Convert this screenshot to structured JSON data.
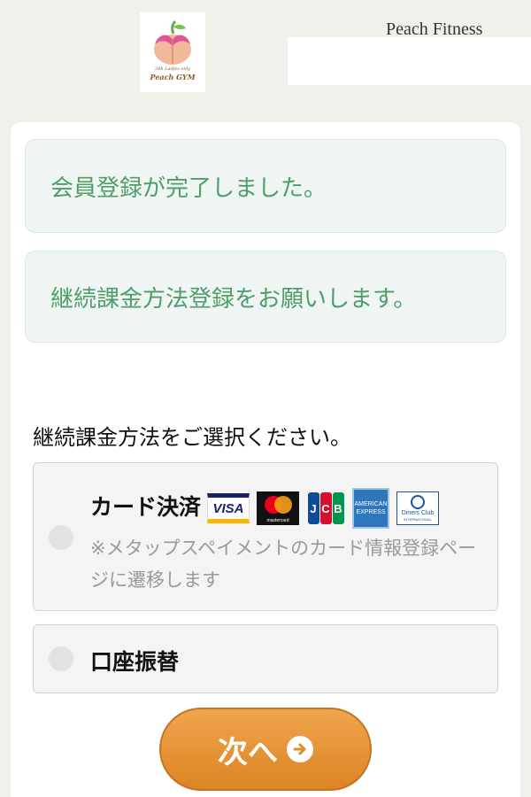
{
  "header": {
    "logo_small": "24h Ladies only",
    "logo_name": "Peach GYM",
    "brand": "Peach Fitness"
  },
  "messages": [
    "会員登録が完了しました。",
    "継続課金方法登録をお願いします。"
  ],
  "payment": {
    "label": "継続課金方法をご選択ください。",
    "options": [
      {
        "label": "カード決済",
        "note": "※メタップスペイメントのカード情報登録ページに遷移します",
        "card_brands": {
          "visa": "VISA",
          "mastercard": "mastercard",
          "jcb": [
            "J",
            "C",
            "B"
          ],
          "amex": [
            "AMERICAN",
            "EXPRESS"
          ],
          "diners": [
            "Diners Club",
            "INTERNATIONAL"
          ]
        }
      },
      {
        "label": "口座振替"
      }
    ]
  },
  "next_button": {
    "label": "次へ",
    "icon": "arrow-right-circle-icon"
  },
  "colors": {
    "accent_green": "#4e9d6a",
    "button_orange": "#e6932f",
    "background": "#f1f0ea"
  }
}
